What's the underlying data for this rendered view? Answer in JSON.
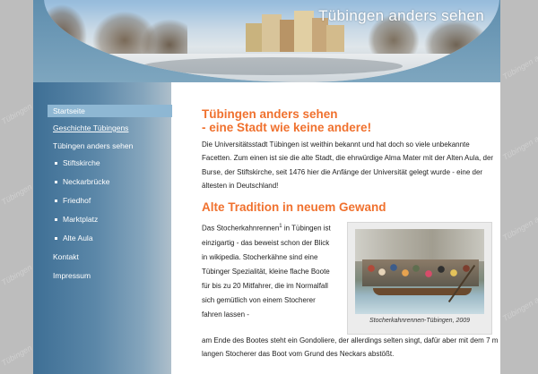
{
  "banner": {
    "title": "Tübingen anders sehen"
  },
  "watermark": "Tübingen anders sehen",
  "nav": {
    "items": [
      {
        "label": "Startseite",
        "active": true
      },
      {
        "label": "Geschichte Tübingens",
        "underline": true
      },
      {
        "label": "Tübingen anders sehen"
      },
      {
        "label": "Stiftskirche",
        "sub": true
      },
      {
        "label": "Neckarbrücke",
        "sub": true
      },
      {
        "label": "Friedhof",
        "sub": true
      },
      {
        "label": "Marktplatz",
        "sub": true
      },
      {
        "label": "Alte Aula",
        "sub": true
      },
      {
        "label": "Kontakt"
      },
      {
        "label": "Impressum"
      }
    ]
  },
  "content": {
    "heading_line1": "Tübingen anders sehen",
    "heading_line2": "- eine Stadt wie keine andere!",
    "intro": "Die Universitätsstadt Tübingen ist weithin bekannt und hat doch so viele unbekannte Facetten. Zum einen ist sie die alte Stadt, die ehrwürdige Alma Mater mit der Alten Aula, der Burse, der Stiftskirche, seit 1476 hier die Anfänge der Universität gelegt wurde - eine der ältesten in Deutschland!",
    "section_heading": "Alte Tradition in neuem Gewand",
    "para_before_sup": "Das Stocherkahnrennen",
    "footnote_mark": "1",
    "para_after_sup": " in Tübingen ist einzigartig - das beweist schon der Blick in wikipedia. Stocherkähne sind eine Tübinger Spezialität, kleine flache Boote für bis zu 20 Mitfahrer, die im Normalfall sich gemütlich von einem Stocherer fahren lassen -",
    "para_cont": "am Ende des Bootes steht ein Gondoliere, der allerdings selten singt, dafür aber mit dem 7 m langen Stocherer das Boot vom Grund des Neckars abstößt.",
    "figure_caption": "Stocherkahnrennen-Tübingen, 2009"
  },
  "colors": {
    "accent": "#f0712e",
    "sidebar": "#4f7fa3",
    "active_nav": "#8eb7d3"
  }
}
